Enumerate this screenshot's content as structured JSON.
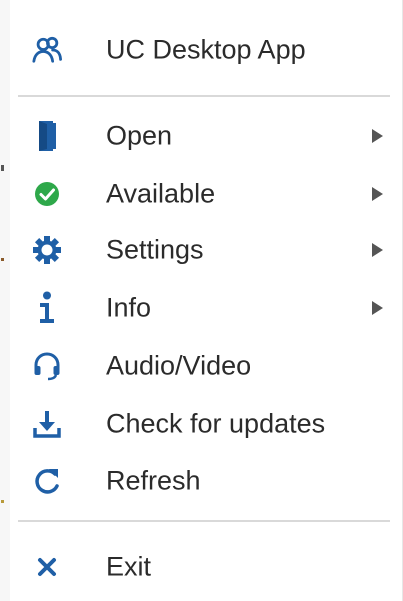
{
  "header": {
    "title": "UC Desktop App",
    "icon": "users-icon"
  },
  "menu": {
    "items": [
      {
        "label": "Open",
        "icon": "door-icon",
        "submenu": true
      },
      {
        "label": "Available",
        "icon": "check-circle-icon",
        "submenu": true,
        "status_color": "#2ea84a"
      },
      {
        "label": "Settings",
        "icon": "gear-icon",
        "submenu": true
      },
      {
        "label": "Info",
        "icon": "info-icon",
        "submenu": true
      },
      {
        "label": "Audio/Video",
        "icon": "headset-icon",
        "submenu": false
      },
      {
        "label": "Check for updates",
        "icon": "download-icon",
        "submenu": false
      },
      {
        "label": "Refresh",
        "icon": "refresh-icon",
        "submenu": false
      }
    ],
    "exit": {
      "label": "Exit",
      "icon": "close-icon"
    }
  },
  "colors": {
    "accent": "#1f5fa6",
    "available": "#2ea84a",
    "text": "#2b2b2b",
    "arrow": "#555555"
  }
}
